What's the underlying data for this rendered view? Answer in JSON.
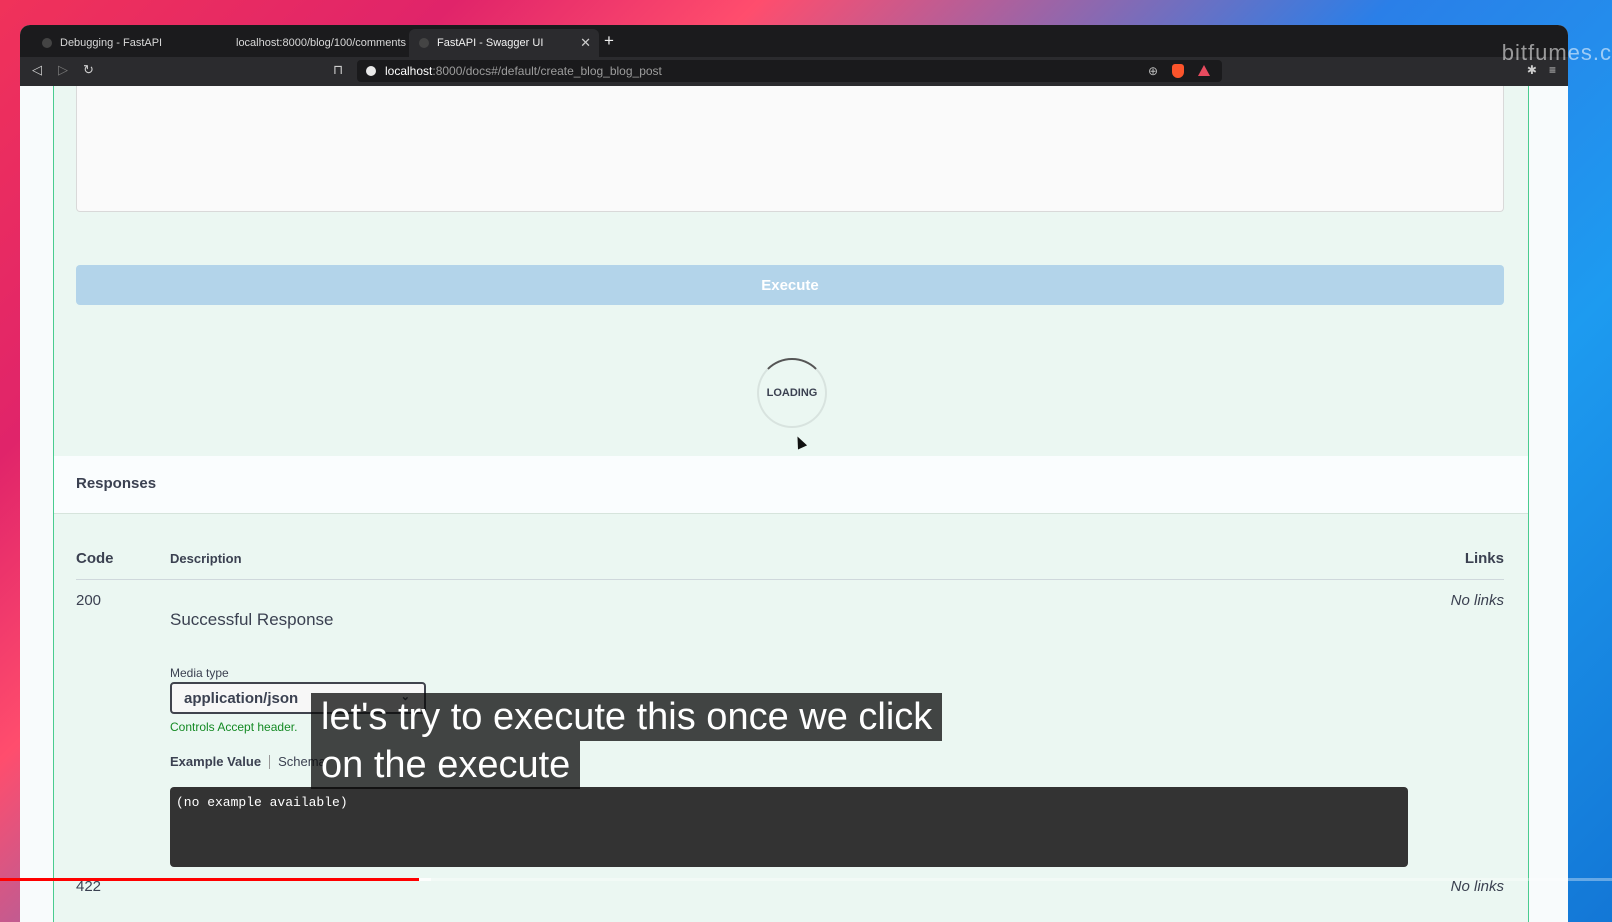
{
  "browser": {
    "tabs": [
      {
        "label": "Debugging - FastAPI"
      },
      {
        "label": "localhost:8000/blog/100/comments"
      },
      {
        "label": "FastAPI - Swagger UI",
        "active": true
      }
    ],
    "url_host": "localhost",
    "url_path": ":8000/docs#/default/create_blog_blog_post",
    "watermark": "bitfumes.c"
  },
  "page": {
    "execute_label": "Execute",
    "loading_label": "LOADING",
    "responses_title": "Responses",
    "columns": {
      "code": "Code",
      "description": "Description",
      "links": "Links"
    },
    "response_200": {
      "code": "200",
      "description": "Successful Response",
      "links": "No links",
      "media_type_label": "Media type",
      "media_type_value": "application/json",
      "controls_accept": "Controls Accept header.",
      "tab_example": "Example Value",
      "tab_schema": "Schema",
      "example_text": "(no example available)"
    },
    "response_422": {
      "code": "422",
      "links": "No links"
    }
  },
  "video": {
    "caption_line1": "let's try to execute this once we click",
    "caption_line2": "on the execute",
    "progress_fraction": 0.26
  },
  "colors": {
    "accent_green": "#49cc90",
    "execute_bg": "#b3d4ea",
    "progress_red": "#ff0000"
  }
}
